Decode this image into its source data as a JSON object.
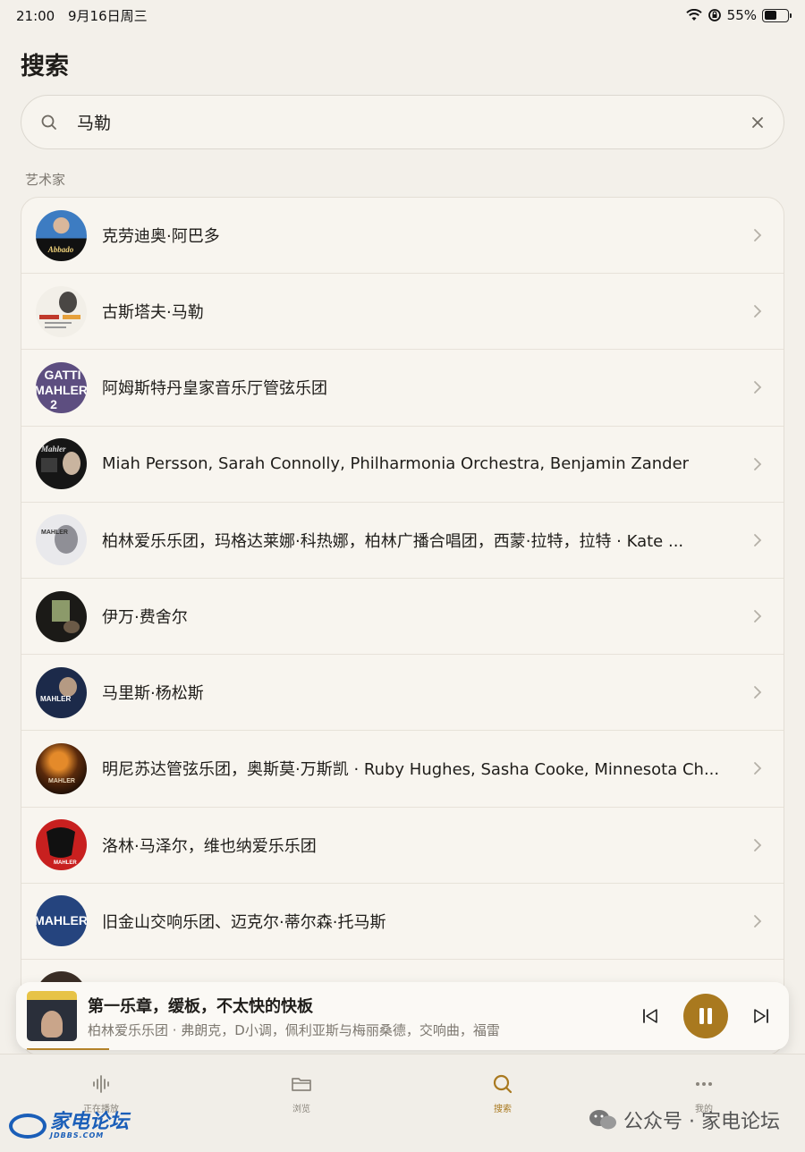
{
  "status_bar": {
    "time": "21:00",
    "date": "9月16日周三",
    "battery": "55%",
    "battery_level": 0.55
  },
  "page": {
    "title": "搜索"
  },
  "search": {
    "value": "马勒",
    "placeholder": ""
  },
  "section": {
    "label": "艺术家"
  },
  "artists": [
    {
      "label": "克劳迪奥·阿巴多",
      "art": "abbado"
    },
    {
      "label": "古斯塔夫·马勒",
      "art": "mahler-portrait"
    },
    {
      "label": "阿姆斯特丹皇家音乐厅管弦乐团",
      "art": "gatti-mahler"
    },
    {
      "label": "Miah Persson, Sarah Connolly, Philharmonia Orchestra, Benjamin Zander",
      "art": "zander"
    },
    {
      "label": "柏林爱乐乐团，玛格达莱娜·科热娜，柏林广播合唱团，西蒙·拉特，拉特 · Kate ...",
      "art": "rattle"
    },
    {
      "label": "伊万·费舍尔",
      "art": "fischer"
    },
    {
      "label": "马里斯·杨松斯",
      "art": "jansons"
    },
    {
      "label": "明尼苏达管弦乐团，奥斯莫·万斯凯 · Ruby Hughes, Sasha Cooke, Minnesota Ch...",
      "art": "vanska"
    },
    {
      "label": "洛林·马泽尔，维也纳爱乐乐团",
      "art": "maazel"
    },
    {
      "label": "旧金山交响乐团、迈克尔·蒂尔森·托马斯",
      "art": "sf-mahler"
    }
  ],
  "now_playing": {
    "title": "第一乐章，缓板，不太快的快板",
    "subtitle": "柏林爱乐乐团 · 弗朗克，D小调，佩利亚斯与梅丽桑德，交响曲，福雷",
    "progress": 0.11
  },
  "tabs": [
    {
      "label": "正在播放",
      "icon": "waveform-icon",
      "active": false
    },
    {
      "label": "浏览",
      "icon": "folder-icon",
      "active": false
    },
    {
      "label": "搜索",
      "icon": "search-icon",
      "active": true
    },
    {
      "label": "我的",
      "icon": "more-icon",
      "active": false
    }
  ],
  "watermark": {
    "left_brand": "家电论坛",
    "left_sub": "JDBBS.COM",
    "right_text": "公众号 · 家电论坛"
  },
  "colors": {
    "background": "#f3f0ea",
    "accent": "#a9791f",
    "text": "#1f1d1a",
    "muted": "#7d7870"
  }
}
